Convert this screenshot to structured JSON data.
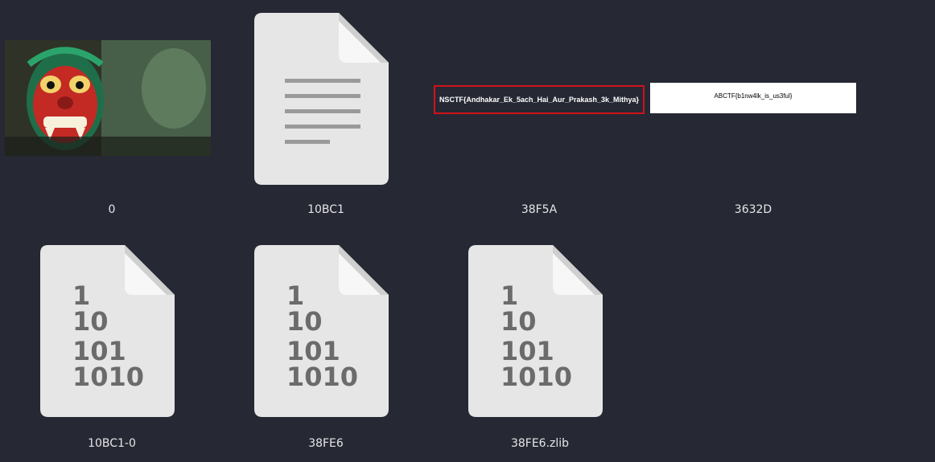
{
  "files": [
    {
      "name": "0",
      "type": "image"
    },
    {
      "name": "10BC1",
      "type": "text-document"
    },
    {
      "name": "38F5A",
      "type": "image-text",
      "image_text": "NSCTF{Andhakar_Ek_5ach_Hai_Aur_Prakash_3k_Mithya}"
    },
    {
      "name": "3632D",
      "type": "image-text",
      "image_text": "ABCTF{b1nw4lk_is_us3ful}"
    },
    {
      "name": "10BC1-0",
      "type": "binary",
      "binary_lines": [
        "1",
        "10",
        "101",
        "1010"
      ]
    },
    {
      "name": "38FE6",
      "type": "binary",
      "binary_lines": [
        "1",
        "10",
        "101",
        "1010"
      ]
    },
    {
      "name": "38FE6.zlib",
      "type": "binary",
      "binary_lines": [
        "1",
        "10",
        "101",
        "1010"
      ]
    }
  ],
  "colors": {
    "background": "#262834",
    "doc_fill": "#e6e6e6",
    "doc_fold": "#f5f5f5",
    "highlight_border": "#d0121b"
  }
}
